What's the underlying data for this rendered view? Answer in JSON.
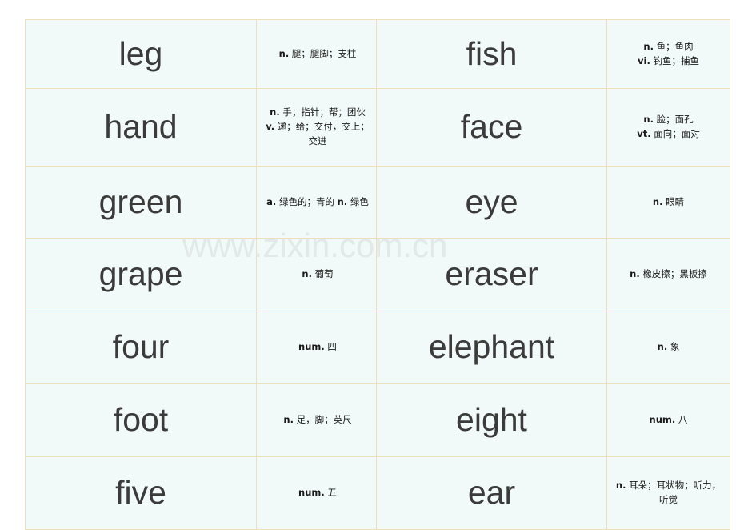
{
  "page": {
    "background_color": "#ffffff",
    "cell_background_color": "#f1faf8",
    "border_color": "#efdfba",
    "word_text_color": "#3b3b3b",
    "definition_text_color": "#1a1a1a"
  },
  "watermark": {
    "text": "www.zixin.com.cn",
    "color": "#e3e8e8"
  },
  "tables": {
    "left": {
      "rows": [
        {
          "word": "leg",
          "definitions": [
            {
              "pos": "n.",
              "meaning": "腿；腿脚；支柱"
            }
          ]
        },
        {
          "word": "hand",
          "definitions": [
            {
              "pos": "n.",
              "meaning": "手；指针；帮；团伙"
            },
            {
              "pos": "v.",
              "meaning": "递；给；交付，交上；交进"
            }
          ]
        },
        {
          "word": "green",
          "definitions": [
            {
              "pos": "a.",
              "meaning": "绿色的；青的"
            },
            {
              "pos": "n.",
              "meaning": "绿色"
            }
          ]
        },
        {
          "word": "grape",
          "definitions": [
            {
              "pos": "n.",
              "meaning": "葡萄"
            }
          ]
        },
        {
          "word": "four",
          "definitions": [
            {
              "pos": "num.",
              "meaning": "四"
            }
          ]
        },
        {
          "word": "foot",
          "definitions": [
            {
              "pos": "n.",
              "meaning": "足，脚；英尺"
            }
          ]
        },
        {
          "word": "five",
          "definitions": [
            {
              "pos": "num.",
              "meaning": "五"
            }
          ]
        }
      ]
    },
    "right": {
      "rows": [
        {
          "word": "fish",
          "definitions": [
            {
              "pos": "n.",
              "meaning": "鱼；鱼肉"
            },
            {
              "pos": "vi.",
              "meaning": "钓鱼；捕鱼"
            }
          ]
        },
        {
          "word": "face",
          "definitions": [
            {
              "pos": "n.",
              "meaning": "脸；面孔"
            },
            {
              "pos": "vt.",
              "meaning": "面向；面对"
            }
          ]
        },
        {
          "word": "eye",
          "definitions": [
            {
              "pos": "n.",
              "meaning": "眼睛"
            }
          ]
        },
        {
          "word": "eraser",
          "definitions": [
            {
              "pos": "n.",
              "meaning": "橡皮擦；黑板擦"
            }
          ]
        },
        {
          "word": "elephant",
          "definitions": [
            {
              "pos": "n.",
              "meaning": "象"
            }
          ]
        },
        {
          "word": "eight",
          "definitions": [
            {
              "pos": "num.",
              "meaning": "八"
            }
          ]
        },
        {
          "word": "ear",
          "definitions": [
            {
              "pos": "n.",
              "meaning": "耳朵；耳状物；听力，听觉"
            }
          ]
        }
      ]
    }
  }
}
